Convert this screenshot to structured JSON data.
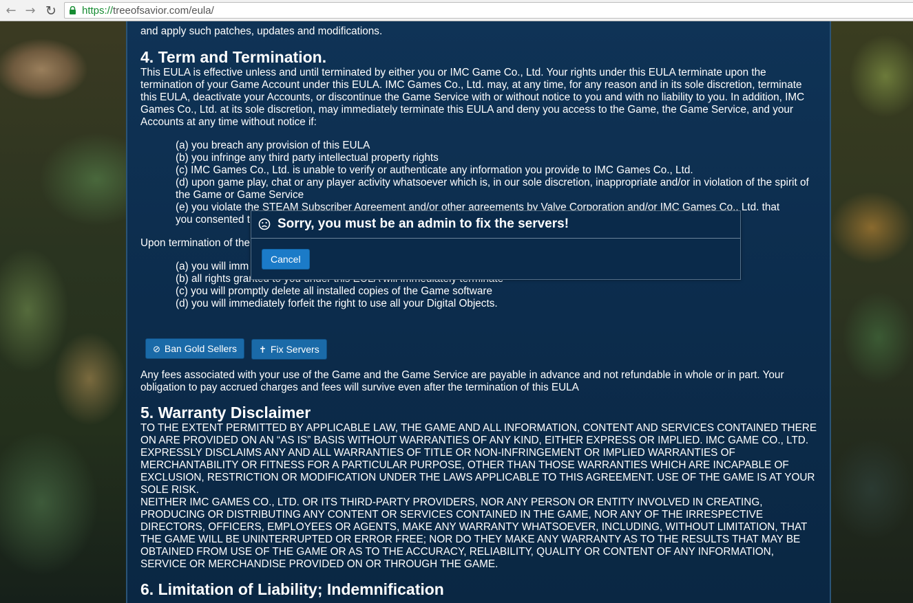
{
  "browser": {
    "url_protocol": "https://",
    "url_rest": "treeofsavior.com/eula/"
  },
  "content": {
    "top_fragment": "and apply such patches, updates and modifications.",
    "section4": {
      "heading": "4. Term and Termination.",
      "paragraph": "This EULA is effective unless and until terminated by either you or IMC Game Co., Ltd. Your rights under this EULA terminate upon the termination of your Game Account under this EULA. IMC Games Co., Ltd. may, at any time, for any reason and in its sole discretion, terminate this EULA, deactivate your Accounts, or discontinue the Game Service with or without notice to you and with no liability to you. In addition, IMC Games Co., Ltd. at its sole discretion, may immediately terminate this EULA and deny you access to the Game, the Game Service, and your Accounts at any time without notice if:",
      "conditions": [
        "(a) you breach any provision of this EULA",
        "(b) you infringe any third party intellectual property rights",
        "(c) IMC Games Co., Ltd. is unable to verify or authenticate any information you provide to IMC Games Co., Ltd.",
        "(d) upon game play, chat or any player activity whatsoever which is, in our sole discretion, inappropriate and/or in violation of the spirit of the Game or Game Service",
        "(e) you violate the STEAM Subscriber Agreement and/or other agreements by Valve Corporation and/or IMC Games Co., Ltd. that",
        "you consented t"
      ],
      "upon_termination": "Upon termination of the",
      "consequences": [
        "(a) you will imm",
        "(b) all rights granted to you under this EULA will immediately terminate",
        "(c) you will promptly delete all installed copies of the Game software",
        "(d) you will immediately forfeit the right to use all your Digital Objects."
      ],
      "fees_paragraph": "Any fees associated with your use of the Game and the Game Service are payable in advance and not refundable in whole or in part. Your obligation to pay accrued charges and fees will survive even after the termination of this EULA"
    },
    "buttons": {
      "ban_gold_sellers": "Ban Gold Sellers",
      "fix_servers": "Fix Servers"
    },
    "section5": {
      "heading": "5. Warranty Disclaimer",
      "paragraph1": "TO THE EXTENT PERMITTED BY APPLICABLE LAW, THE GAME AND ALL INFORMATION, CONTENT AND SERVICES CONTAINED THERE ON ARE PROVIDED ON AN “AS IS” BASIS WITHOUT WARRANTIES OF ANY KIND, EITHER EXPRESS OR IMPLIED. IMC GAME CO., LTD. EXPRESSLY DISCLAIMS ANY AND ALL WARRANTIES OF TITLE OR NON-INFRINGEMENT OR IMPLIED WARRANTIES OF MERCHANTABILITY OR FITNESS FOR A PARTICULAR PURPOSE, OTHER THAN THOSE WARRANTIES WHICH ARE INCAPABLE OF EXCLUSION, RESTRICTION OR MODIFICATION UNDER THE LAWS APPLICABLE TO THIS AGREEMENT. USE OF THE GAME IS AT YOUR SOLE RISK.",
      "paragraph2": "NEITHER IMC GAMES CO., LTD. OR ITS THIRD-PARTY PROVIDERS, NOR ANY PERSON OR ENTITY INVOLVED IN CREATING, PRODUCING OR DISTRIBUTING ANY CONTENT OR SERVICES CONTAINED IN THE GAME, NOR ANY OF THE IRRESPECTIVE DIRECTORS, OFFICERS, EMPLOYEES OR AGENTS, MAKE ANY WARRANTY WHATSOEVER, INCLUDING, WITHOUT LIMITATION, THAT THE GAME WILL BE UNINTERRUPTED OR ERROR FREE; NOR DO THEY MAKE ANY WARRANTY AS TO THE RESULTS THAT MAY BE OBTAINED FROM USE OF THE GAME OR AS TO THE ACCURACY, RELIABILITY, QUALITY OR CONTENT OF ANY INFORMATION, SERVICE OR MERCHANDISE PROVIDED ON OR THROUGH THE GAME."
    },
    "section6": {
      "heading": "6. Limitation of Liability; Indemnification"
    }
  },
  "modal": {
    "icon": "sad-face-icon",
    "title": "Sorry, you must be an admin to fix the servers!",
    "cancel_label": "Cancel"
  },
  "colors": {
    "panel_bg": "#0c2c4c",
    "button_bg": "#1a6aa8",
    "modal_bg": "#0a2a4a",
    "url_protocol": "#168c32"
  }
}
